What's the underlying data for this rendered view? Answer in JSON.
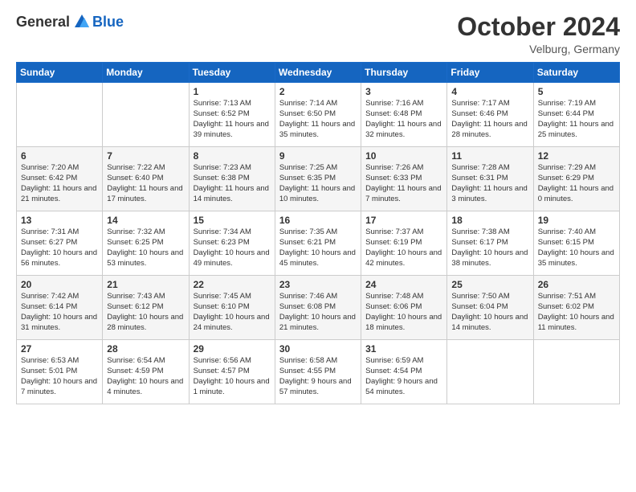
{
  "header": {
    "logo_general": "General",
    "logo_blue": "Blue",
    "month_title": "October 2024",
    "subtitle": "Velburg, Germany"
  },
  "days_of_week": [
    "Sunday",
    "Monday",
    "Tuesday",
    "Wednesday",
    "Thursday",
    "Friday",
    "Saturday"
  ],
  "weeks": [
    [
      {
        "day": "",
        "info": ""
      },
      {
        "day": "",
        "info": ""
      },
      {
        "day": "1",
        "info": "Sunrise: 7:13 AM\nSunset: 6:52 PM\nDaylight: 11 hours and 39 minutes."
      },
      {
        "day": "2",
        "info": "Sunrise: 7:14 AM\nSunset: 6:50 PM\nDaylight: 11 hours and 35 minutes."
      },
      {
        "day": "3",
        "info": "Sunrise: 7:16 AM\nSunset: 6:48 PM\nDaylight: 11 hours and 32 minutes."
      },
      {
        "day": "4",
        "info": "Sunrise: 7:17 AM\nSunset: 6:46 PM\nDaylight: 11 hours and 28 minutes."
      },
      {
        "day": "5",
        "info": "Sunrise: 7:19 AM\nSunset: 6:44 PM\nDaylight: 11 hours and 25 minutes."
      }
    ],
    [
      {
        "day": "6",
        "info": "Sunrise: 7:20 AM\nSunset: 6:42 PM\nDaylight: 11 hours and 21 minutes."
      },
      {
        "day": "7",
        "info": "Sunrise: 7:22 AM\nSunset: 6:40 PM\nDaylight: 11 hours and 17 minutes."
      },
      {
        "day": "8",
        "info": "Sunrise: 7:23 AM\nSunset: 6:38 PM\nDaylight: 11 hours and 14 minutes."
      },
      {
        "day": "9",
        "info": "Sunrise: 7:25 AM\nSunset: 6:35 PM\nDaylight: 11 hours and 10 minutes."
      },
      {
        "day": "10",
        "info": "Sunrise: 7:26 AM\nSunset: 6:33 PM\nDaylight: 11 hours and 7 minutes."
      },
      {
        "day": "11",
        "info": "Sunrise: 7:28 AM\nSunset: 6:31 PM\nDaylight: 11 hours and 3 minutes."
      },
      {
        "day": "12",
        "info": "Sunrise: 7:29 AM\nSunset: 6:29 PM\nDaylight: 11 hours and 0 minutes."
      }
    ],
    [
      {
        "day": "13",
        "info": "Sunrise: 7:31 AM\nSunset: 6:27 PM\nDaylight: 10 hours and 56 minutes."
      },
      {
        "day": "14",
        "info": "Sunrise: 7:32 AM\nSunset: 6:25 PM\nDaylight: 10 hours and 53 minutes."
      },
      {
        "day": "15",
        "info": "Sunrise: 7:34 AM\nSunset: 6:23 PM\nDaylight: 10 hours and 49 minutes."
      },
      {
        "day": "16",
        "info": "Sunrise: 7:35 AM\nSunset: 6:21 PM\nDaylight: 10 hours and 45 minutes."
      },
      {
        "day": "17",
        "info": "Sunrise: 7:37 AM\nSunset: 6:19 PM\nDaylight: 10 hours and 42 minutes."
      },
      {
        "day": "18",
        "info": "Sunrise: 7:38 AM\nSunset: 6:17 PM\nDaylight: 10 hours and 38 minutes."
      },
      {
        "day": "19",
        "info": "Sunrise: 7:40 AM\nSunset: 6:15 PM\nDaylight: 10 hours and 35 minutes."
      }
    ],
    [
      {
        "day": "20",
        "info": "Sunrise: 7:42 AM\nSunset: 6:14 PM\nDaylight: 10 hours and 31 minutes."
      },
      {
        "day": "21",
        "info": "Sunrise: 7:43 AM\nSunset: 6:12 PM\nDaylight: 10 hours and 28 minutes."
      },
      {
        "day": "22",
        "info": "Sunrise: 7:45 AM\nSunset: 6:10 PM\nDaylight: 10 hours and 24 minutes."
      },
      {
        "day": "23",
        "info": "Sunrise: 7:46 AM\nSunset: 6:08 PM\nDaylight: 10 hours and 21 minutes."
      },
      {
        "day": "24",
        "info": "Sunrise: 7:48 AM\nSunset: 6:06 PM\nDaylight: 10 hours and 18 minutes."
      },
      {
        "day": "25",
        "info": "Sunrise: 7:50 AM\nSunset: 6:04 PM\nDaylight: 10 hours and 14 minutes."
      },
      {
        "day": "26",
        "info": "Sunrise: 7:51 AM\nSunset: 6:02 PM\nDaylight: 10 hours and 11 minutes."
      }
    ],
    [
      {
        "day": "27",
        "info": "Sunrise: 6:53 AM\nSunset: 5:01 PM\nDaylight: 10 hours and 7 minutes."
      },
      {
        "day": "28",
        "info": "Sunrise: 6:54 AM\nSunset: 4:59 PM\nDaylight: 10 hours and 4 minutes."
      },
      {
        "day": "29",
        "info": "Sunrise: 6:56 AM\nSunset: 4:57 PM\nDaylight: 10 hours and 1 minute."
      },
      {
        "day": "30",
        "info": "Sunrise: 6:58 AM\nSunset: 4:55 PM\nDaylight: 9 hours and 57 minutes."
      },
      {
        "day": "31",
        "info": "Sunrise: 6:59 AM\nSunset: 4:54 PM\nDaylight: 9 hours and 54 minutes."
      },
      {
        "day": "",
        "info": ""
      },
      {
        "day": "",
        "info": ""
      }
    ]
  ]
}
